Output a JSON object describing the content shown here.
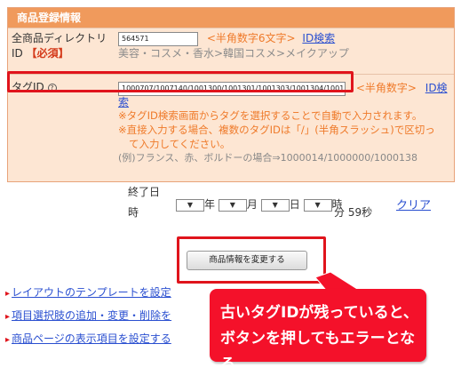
{
  "panel": {
    "title": "商品登録情報",
    "directory": {
      "label_line1": "全商品ディレクトリ",
      "label_line2": "ID",
      "required": "【必須】",
      "input_value": "564571",
      "hint": "<半角数字6文字>",
      "search_link": "ID検索",
      "path": "美容・コスメ・香水>韓国コスメ>メイクアップ"
    },
    "tag": {
      "label": "タグID",
      "help_icon": "help-icon",
      "input_value": "1000707/1007140/1001300/1001301/1001303/1001304/100130",
      "hint": "<半角数字>",
      "search_link_part1": "ID検",
      "search_link_part2": "索",
      "note1": "※タグID検索画面からタグを選択することで自動で入力されます。",
      "note2_line1": "※直接入力する場合、複数のタグIDは「/」(半角スラッシュ)で区切っ",
      "note2_line2": "て入力してください。",
      "example": "(例)フランス、赤、ボルドーの場合⇒1000014/1000000/1000138"
    }
  },
  "schedule": {
    "partial_label_top": "終了日",
    "partial_label_bottom": "時",
    "select_marker": "▼",
    "year": "年",
    "month": "月",
    "day": "日",
    "hour": "時",
    "minute_fragment": "分",
    "minute_second": "分 59秒",
    "clear_link": "クリア"
  },
  "submit_label": "商品情報を変更する",
  "links": [
    {
      "arrow": "▸",
      "label": "レイアウトのテンプレートを設定"
    },
    {
      "arrow": "▸",
      "label": "項目選択肢の追加・変更・削除を"
    },
    {
      "arrow": "▸",
      "label": "商品ページの表示項目を設定する"
    }
  ],
  "callout": {
    "line1": "古いタグIDが残っていると、",
    "line2": "ボタンを押してもエラーとなる"
  },
  "colors": {
    "header": "#f09a5c",
    "row_bg": "#fde6d3",
    "accent": "#ef7a2a",
    "link": "#2a4fd0",
    "highlight": "#e0141c",
    "callout_bg": "#f4112a"
  }
}
